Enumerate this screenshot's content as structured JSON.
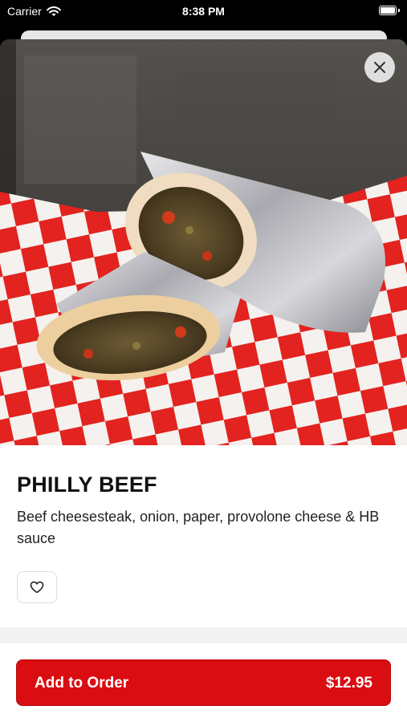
{
  "status_bar": {
    "carrier": "Carrier",
    "time": "8:38 PM"
  },
  "product": {
    "name": "PHILLY BEEF",
    "description": "Beef cheesesteak, onion, paper, provolone cheese & HB sauce",
    "photo_subject": "philly cheesesteak wrap in foil on red checkered paper"
  },
  "actions": {
    "add_to_order_label": "Add to Order",
    "price": "$12.95"
  },
  "icons": {
    "close": "close-icon",
    "favorite": "heart-icon",
    "wifi": "wifi-icon",
    "battery": "battery-icon"
  },
  "colors": {
    "accent": "#d90d12",
    "checker_red": "#e2231f"
  }
}
